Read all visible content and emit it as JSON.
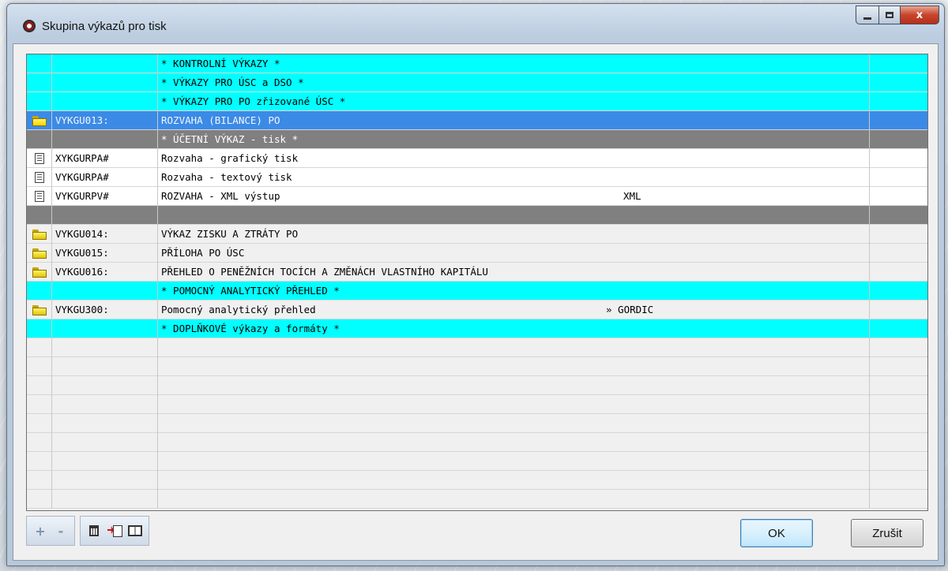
{
  "window": {
    "title": "Skupina výkazů pro tisk",
    "close_glyph": "x"
  },
  "rows": [
    {
      "style": "cyan",
      "icon": "",
      "code": "",
      "name": "* KONTROLNÍ VÝKAZY *",
      "extra": ""
    },
    {
      "style": "cyan",
      "icon": "",
      "code": "",
      "name": "* VÝKAZY PRO ÚSC a DSO *",
      "extra": ""
    },
    {
      "style": "cyan",
      "icon": "",
      "code": "",
      "name": "* VÝKAZY PRO PO zřizované ÚSC *",
      "extra": ""
    },
    {
      "style": "sel",
      "icon": "folder-open-icon",
      "code": "VYKGU013:",
      "name": "ROZVAHA (BILANCE) PO",
      "extra": ""
    },
    {
      "style": "gray",
      "icon": "",
      "code": "",
      "name": "* ÚČETNÍ VÝKAZ - tisk *",
      "extra": ""
    },
    {
      "style": "white",
      "icon": "document-icon",
      "code": "XYKGURPA#",
      "name": "Rozvaha - grafický tisk",
      "extra": ""
    },
    {
      "style": "white",
      "icon": "document-icon",
      "code": "VYKGURPA#",
      "name": "Rozvaha - textový tisk",
      "extra": ""
    },
    {
      "style": "white",
      "icon": "document-icon",
      "code": "VYKGURPV#",
      "name": "ROZVAHA - XML výstup",
      "extra": "XML"
    },
    {
      "style": "gray",
      "icon": "",
      "code": "",
      "name": "",
      "extra": ""
    },
    {
      "style": "light",
      "icon": "folder-icon",
      "code": "VYKGU014:",
      "name": "VÝKAZ ZISKU A ZTRÁTY PO",
      "extra": ""
    },
    {
      "style": "light",
      "icon": "folder-icon",
      "code": "VYKGU015:",
      "name": "PŘÍLOHA PO ÚSC",
      "extra": ""
    },
    {
      "style": "light",
      "icon": "folder-icon",
      "code": "VYKGU016:",
      "name": "PŘEHLED O PENĚŽNÍCH TOCÍCH A ZMĚNÁCH VLASTNÍHO KAPITÁLU",
      "extra": ""
    },
    {
      "style": "cyan",
      "icon": "",
      "code": "",
      "name": "* POMOCNÝ ANALYTICKÝ PŘEHLED *",
      "extra": ""
    },
    {
      "style": "light",
      "icon": "folder-icon",
      "code": "VYKGU300:",
      "name": "Pomocný analytický přehled",
      "extra": "» GORDIC"
    },
    {
      "style": "cyan",
      "icon": "",
      "code": "",
      "name": "* DOPLŇKOVÉ výkazy a formáty *",
      "extra": ""
    }
  ],
  "toolbar": {
    "add_label": "+",
    "remove_label": "-"
  },
  "buttons": {
    "ok_label": "OK",
    "cancel_label": "Zrušit"
  }
}
